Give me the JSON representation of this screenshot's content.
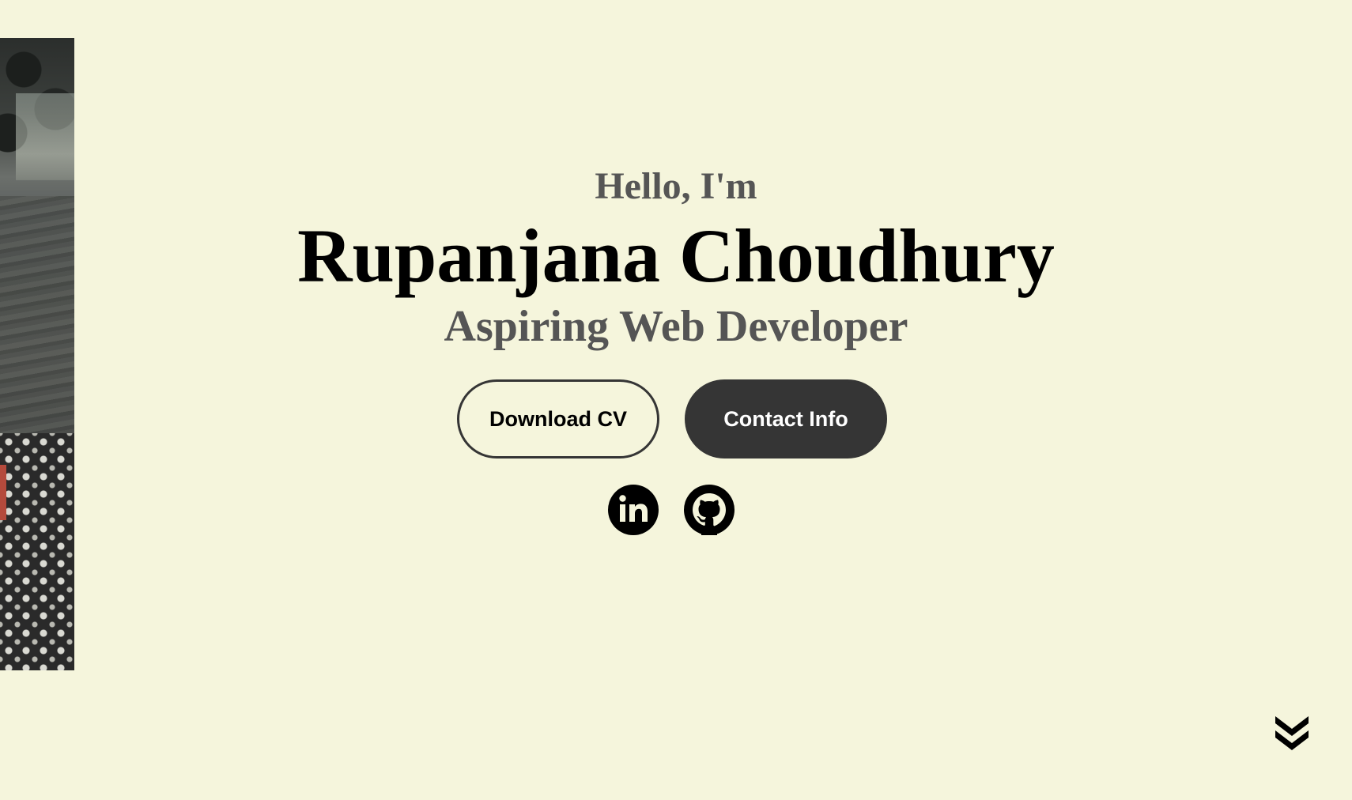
{
  "hero": {
    "greeting": "Hello, I'm",
    "name": "Rupanjana Choudhury",
    "subtitle": "Aspiring Web Developer"
  },
  "buttons": {
    "download_cv": "Download CV",
    "contact_info": "Contact Info"
  },
  "socials": {
    "linkedin_icon": "linkedin-icon",
    "github_icon": "github-icon"
  },
  "nav": {
    "scroll_icon": "double-chevron-down-icon"
  },
  "colors": {
    "background": "#f5f5dc",
    "button_dark": "#353535",
    "subtitle_gray": "#555555"
  }
}
